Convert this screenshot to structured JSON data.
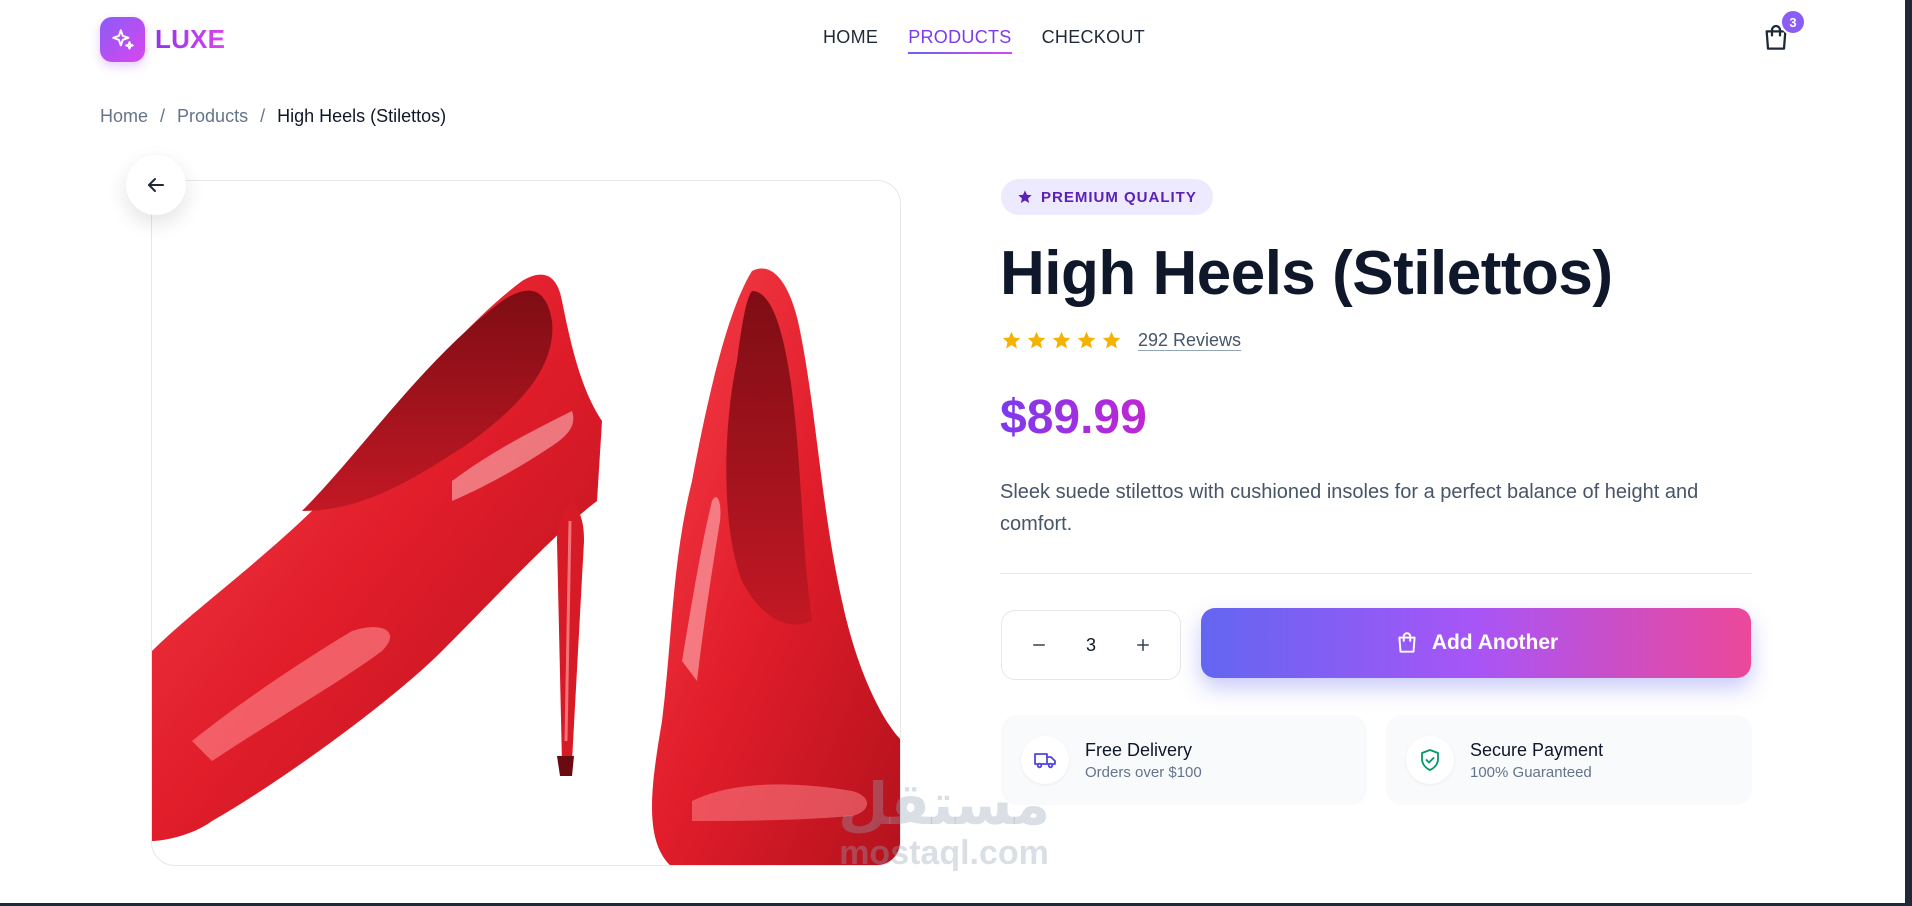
{
  "header": {
    "logo_text": "LUXE",
    "nav": [
      {
        "label": "HOME",
        "active": false
      },
      {
        "label": "PRODUCTS",
        "active": true
      },
      {
        "label": "CHECKOUT",
        "active": false
      }
    ],
    "cart_count": "3"
  },
  "breadcrumb": {
    "items": [
      "Home",
      "Products",
      "High Heels (Stilettos)"
    ],
    "separator": "/"
  },
  "product": {
    "badge": "PREMIUM QUALITY",
    "title": "High Heels (Stilettos)",
    "rating_stars": 5,
    "reviews": "292 Reviews",
    "price": "$89.99",
    "description": "Sleek suede stilettos with cushioned insoles for a perfect balance of height and comfort.",
    "quantity": "3",
    "add_button_label": "Add Another"
  },
  "features": [
    {
      "icon": "truck-icon",
      "title": "Free Delivery",
      "subtitle": "Orders over $100"
    },
    {
      "icon": "shield-check-icon",
      "title": "Secure Payment",
      "subtitle": "100% Guaranteed"
    }
  ],
  "watermark": {
    "arabic": "مستقل",
    "latin": "mostaql.com"
  },
  "colors": {
    "accent": "#7c3aed",
    "accent_pink": "#ec4899",
    "star": "#f5b301",
    "shoe_red": "#e11d2a"
  }
}
